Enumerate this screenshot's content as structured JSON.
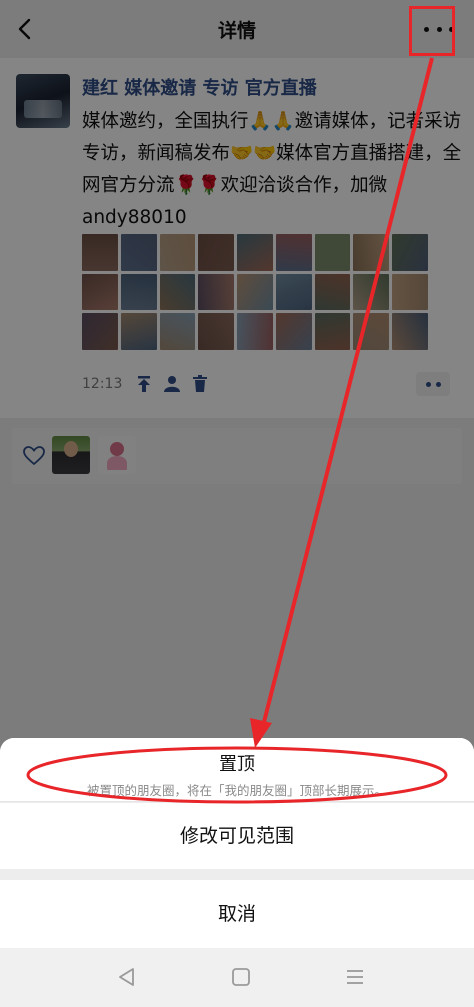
{
  "header": {
    "title": "详情",
    "back_icon": "chevron-left-icon",
    "more_icon": "more-dots-icon"
  },
  "post": {
    "author": "建红 媒体邀请 专访 官方直播",
    "text": "媒体邀约，全国执行🙏🙏邀请媒体，记者采访专访，新闻稿发布🤝🤝媒体官方直播搭建，全网官方分流🌹🌹欢迎洽谈合作，加微andy88010",
    "time": "12:13",
    "photo_count": 27,
    "meta_icons": [
      "share-icon",
      "person-icon",
      "trash-icon"
    ],
    "comment_icon": "comment-dots-icon"
  },
  "likes": {
    "icon": "heart-icon",
    "avatars": [
      "like-avatar",
      "like-avatar"
    ]
  },
  "action_sheet": {
    "pin_label": "置顶",
    "pin_desc": "被置顶的朋友圈，将在「我的朋友圈」顶部长期展示。",
    "visibility_label": "修改可见范围",
    "cancel_label": "取消"
  },
  "navbar": {
    "icons": [
      "back-triangle-icon",
      "home-square-icon",
      "menu-lines-icon"
    ]
  },
  "colors": {
    "name_blue": "#2f4e86",
    "annotation_red": "#e8262a",
    "dim_overlay": "rgba(0,0,0,0.48)",
    "sheet_bg": "#ffffff"
  }
}
